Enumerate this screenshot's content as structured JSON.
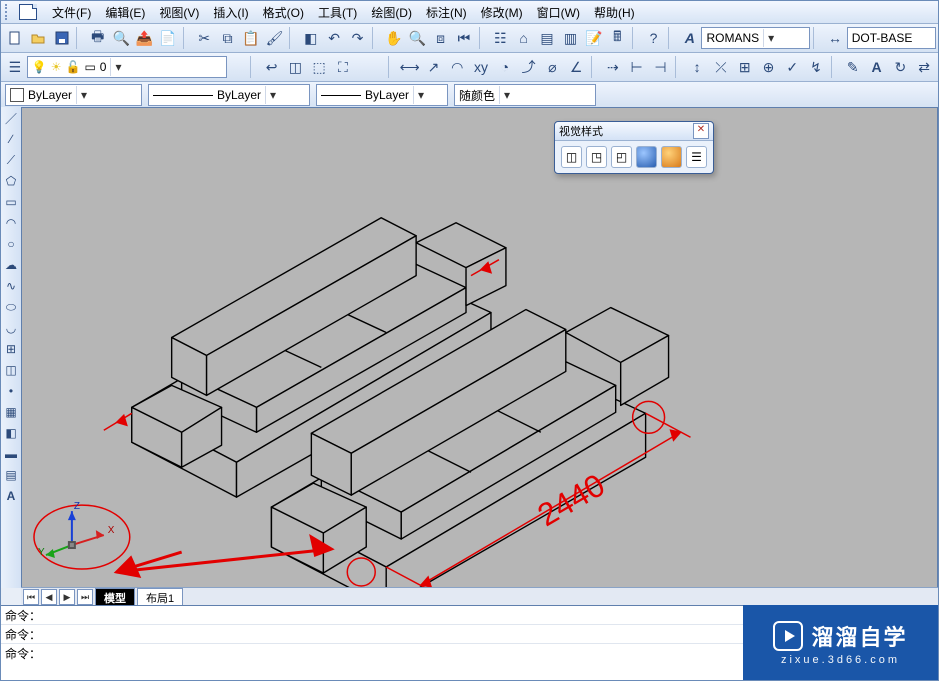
{
  "menu": {
    "items": [
      "文件(F)",
      "编辑(E)",
      "视图(V)",
      "插入(I)",
      "格式(O)",
      "工具(T)",
      "绘图(D)",
      "标注(N)",
      "修改(M)",
      "窗口(W)",
      "帮助(H)"
    ]
  },
  "toolbar": {
    "font_combo": "ROMANS",
    "dimstyle_combo": "DOT-BASE"
  },
  "layers": {
    "current": "0"
  },
  "props": {
    "color_label": "ByLayer",
    "linetype_label": "ByLayer",
    "lineweight_label": "ByLayer",
    "plotstyle_label": "随颜色"
  },
  "visual_styles_panel": {
    "title": "视觉样式"
  },
  "canvas": {
    "dimension_value": "2440",
    "ucs_axes": {
      "x": "X",
      "y": "Y",
      "z": "Z"
    }
  },
  "tabs": {
    "model": "模型",
    "layout1": "布局1"
  },
  "command": {
    "history": [
      "命令：",
      "命令："
    ],
    "prompt": "命令："
  },
  "logo": {
    "line1": "溜溜自学",
    "line2": "zixue.3d66.com"
  },
  "icons": {
    "new": "new",
    "open": "open",
    "save": "save",
    "print": "print",
    "cut": "cut",
    "copy": "copy",
    "paste": "paste",
    "undo": "undo",
    "redo": "redo",
    "pan": "pan",
    "zoom": "zoom"
  }
}
